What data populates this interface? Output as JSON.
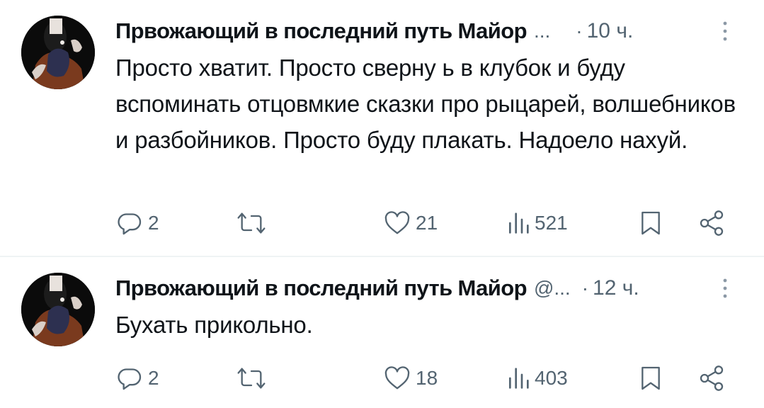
{
  "tweets": [
    {
      "author_name": "Првожающий в последний путь Майор",
      "handle": "...",
      "separator": "·",
      "time": "10 ч.",
      "text": "Просто хватит. Просто сверну ь в клубок и буду вспоминать отцовмкие сказки про рыцарей, волшебников и разбойников. Просто буду плакать. Надоело нахуй.",
      "replies": "2",
      "retweets": "",
      "likes": "21",
      "views": "521"
    },
    {
      "author_name": "Првожающий в последний путь Майор",
      "handle": "@...",
      "separator": "·",
      "time": "12 ч.",
      "text": "Бухать прикольно.",
      "replies": "2",
      "retweets": "",
      "likes": "18",
      "views": "403"
    }
  ],
  "icons": {
    "more": "more-vertical-icon",
    "reply": "reply-icon",
    "retweet": "retweet-icon",
    "like": "heart-icon",
    "views": "views-icon",
    "bookmark": "bookmark-icon",
    "share": "share-icon"
  },
  "colors": {
    "text": "#0f1419",
    "secondary": "#536471",
    "divider": "#eff3f4"
  }
}
